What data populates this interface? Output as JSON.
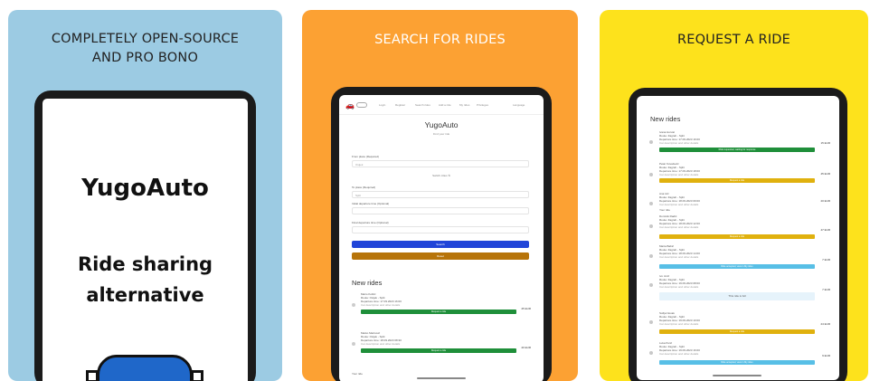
{
  "colors": {
    "panel1_bg": "#9ccbe3",
    "panel2_bg": "#fca133",
    "panel3_bg": "#fde21c",
    "green": "#1f8f3a",
    "gold": "#e0b10e",
    "blue_search": "#2145d8",
    "brown_reset": "#b7740a",
    "cyan": "#58bfe6"
  },
  "panels": [
    {
      "title_line1": "COMPLETELY OPEN-SOURCE",
      "title_line2": "AND PRO BONO",
      "brand": "YugoAuto",
      "tagline_line1": "Ride sharing",
      "tagline_line2": "alternative"
    },
    {
      "title": "SEARCH FOR RIDES",
      "nav": [
        "Login",
        "Register",
        "Search rides",
        "Add a ride",
        "My rides",
        "Privileges",
        "Language"
      ],
      "app_title": "YugoAuto",
      "app_subtitle": "Find your ride",
      "form": {
        "from_label": "From place (Required)",
        "from_value": "Osijek",
        "switch_label": "Switch cities ⇅",
        "to_label": "To place (Required)",
        "to_value": "Split",
        "initial_label": "Initial departure time (Optional)",
        "final_label": "Final departure time (Optional)",
        "search_button": "Search",
        "reset_button": "Reset"
      },
      "new_rides_heading": "New rides",
      "rides": [
        {
          "name": "Mario Koštić",
          "route": "Route: Osijek - Split",
          "time": "Departure time: 17.09.2023 16:00",
          "note": "Car description and other details",
          "price": "25 EUR",
          "action": "Request a ride"
        },
        {
          "name": "Marko Marković",
          "route": "Route: Osijek - Split",
          "time": "Departure time: 18.09.2023 08:30",
          "note": "Car description and other details",
          "price": "20 EUR",
          "action": "Request a ride"
        },
        {
          "name": "Your ride",
          "route": "",
          "time": "",
          "note": "",
          "price": "",
          "action": ""
        }
      ]
    },
    {
      "title": "REQUEST A RIDE",
      "new_rides_heading": "New rides",
      "rides": [
        {
          "name": "Ivana Horvat",
          "route": "Route: Zagreb - Split",
          "time": "Departure time: 17.09.2023 16:00",
          "note": "Car description and other details",
          "price": "15 EUR",
          "action": "Ride requested, waiting for response",
          "status": "green"
        },
        {
          "name": "Petar Kovačević",
          "route": "Route: Zagreb - Split",
          "time": "Departure time: 17.09.2023 18:00",
          "note": "Car description and other details",
          "price": "45 EUR",
          "action": "Request a ride",
          "status": "gold"
        },
        {
          "name": "Ana Ivić",
          "route": "Route: Zagreb - Split",
          "time": "Departure time: 18.09.2023 09:00",
          "note": "Car description and other details",
          "price": "20 EUR",
          "action": "",
          "status": "none"
        },
        {
          "name": "Your ride",
          "route": "",
          "time": "",
          "note": "",
          "price": "",
          "action": "",
          "status": "label"
        },
        {
          "name": "Dominik Radić",
          "route": "Route: Zagreb - Split",
          "time": "Departure time: 18.09.2023 12:00",
          "note": "Car description and other details",
          "price": "47 EUR",
          "action": "Request a ride",
          "status": "gold"
        },
        {
          "name": "Marta Babić",
          "route": "Route: Zagreb - Split",
          "time": "Departure time: 18.09.2023 14:00",
          "note": "Car description and other details",
          "price": "7 EUR",
          "action": "Ride accepted, view in My rides",
          "status": "cyan"
        },
        {
          "name": "Ivo Jurić",
          "route": "Route: Zagreb - Split",
          "time": "Departure time: 19.09.2023 08:00",
          "note": "Car description and other details",
          "price": "7 EUR",
          "action": "This ride is full",
          "status": "light"
        },
        {
          "name": "Sofija Novak",
          "route": "Route: Zagreb - Split",
          "time": "Departure time: 19.09.2023 10:00",
          "note": "Car description and other details",
          "price": "24 EUR",
          "action": "Request a ride",
          "status": "gold"
        },
        {
          "name": "Luka Perić",
          "route": "Route: Zagreb - Split",
          "time": "Departure time: 19.09.2023 16:00",
          "note": "Car description and other details",
          "price": "9 EUR",
          "action": "Ride accepted, view in My rides",
          "status": "cyan"
        }
      ]
    }
  ]
}
